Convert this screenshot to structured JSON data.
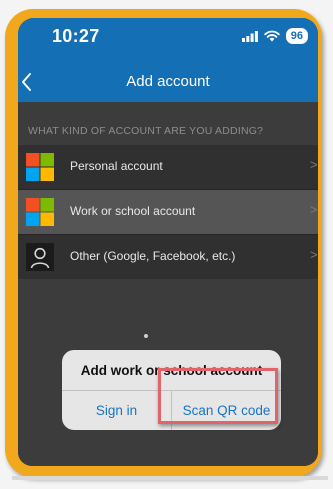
{
  "status_bar": {
    "time": "10:27",
    "battery": "96"
  },
  "nav": {
    "title": "Add account"
  },
  "section_header": "WHAT KIND OF ACCOUNT ARE YOU ADDING?",
  "accounts": [
    {
      "label": "Personal account",
      "icon": "microsoft-logo-icon"
    },
    {
      "label": "Work or school account",
      "icon": "microsoft-logo-icon"
    },
    {
      "label": "Other (Google, Facebook, etc.)",
      "icon": "person-icon"
    }
  ],
  "chevron": ">",
  "dialog": {
    "title": "Add work or school account",
    "sign_in": "Sign in",
    "scan_qr": "Scan QR code"
  },
  "colors": {
    "brand_blue": "#146fb5",
    "frame_orange": "#f2a81d",
    "highlight_red": "#e06468",
    "action_blue": "#1a73c9"
  }
}
